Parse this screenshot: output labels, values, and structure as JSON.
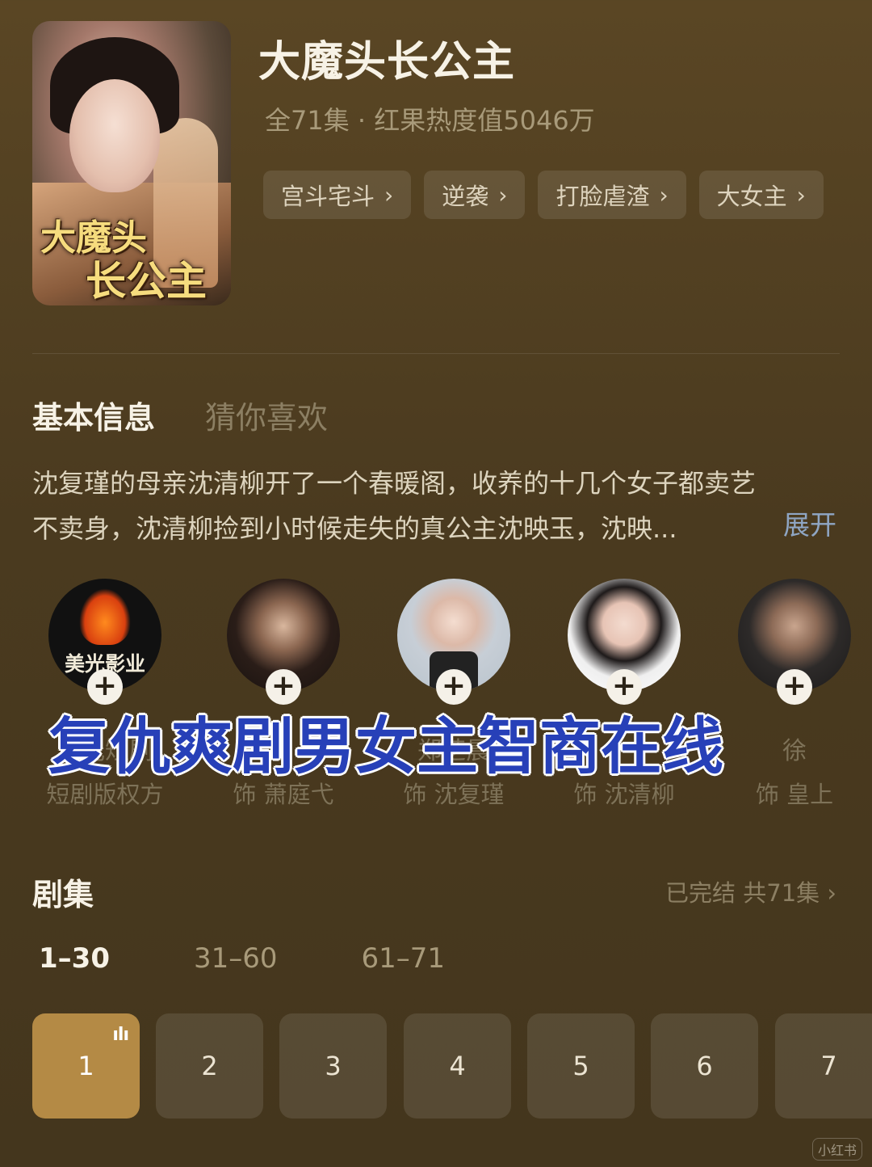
{
  "drama": {
    "title": "大魔头长公主",
    "poster_line1": "大魔头",
    "poster_line2": "长公主",
    "meta": "全71集 · 红果热度值5046万",
    "tags": [
      "宫斗宅斗",
      "逆袭",
      "打脸虐渣",
      "大女主"
    ]
  },
  "tabs": {
    "active": "基本信息",
    "inactive": "猜你喜欢"
  },
  "description": {
    "line1": "沈复瑾的母亲沈清柳开了一个春暖阁，收养的十几个女子都卖艺",
    "line2": "不卖身，沈清柳捡到小时候走失的真公主沈映玉，沈映...",
    "expand": "展开"
  },
  "cast": [
    {
      "avatar": "company-logo",
      "logo_text": "美光影业",
      "name": "美光短剧",
      "role": "短剧版权方"
    },
    {
      "avatar": "actor-photo",
      "name": "",
      "role": "饰 萧庭弋"
    },
    {
      "avatar": "actress-photo",
      "name": "郑芝晨",
      "role": "饰 沈复瑾"
    },
    {
      "avatar": "actress-photo",
      "name": "",
      "role": "饰 沈清柳"
    },
    {
      "avatar": "actor-photo",
      "name": "徐",
      "role": "饰 皇上"
    }
  ],
  "overlay_caption": "复仇爽剧男女主智商在线",
  "episodes": {
    "title": "剧集",
    "status": "已完结 共71集",
    "ranges": [
      "1–30",
      "31–60",
      "61–71"
    ],
    "items": [
      "1",
      "2",
      "3",
      "4",
      "5",
      "6",
      "7"
    ],
    "current": "1"
  },
  "colors": {
    "accent": "#b48a45",
    "link": "#8fa6c4",
    "overlay_text": "#2740b8"
  },
  "watermark": "小红书"
}
